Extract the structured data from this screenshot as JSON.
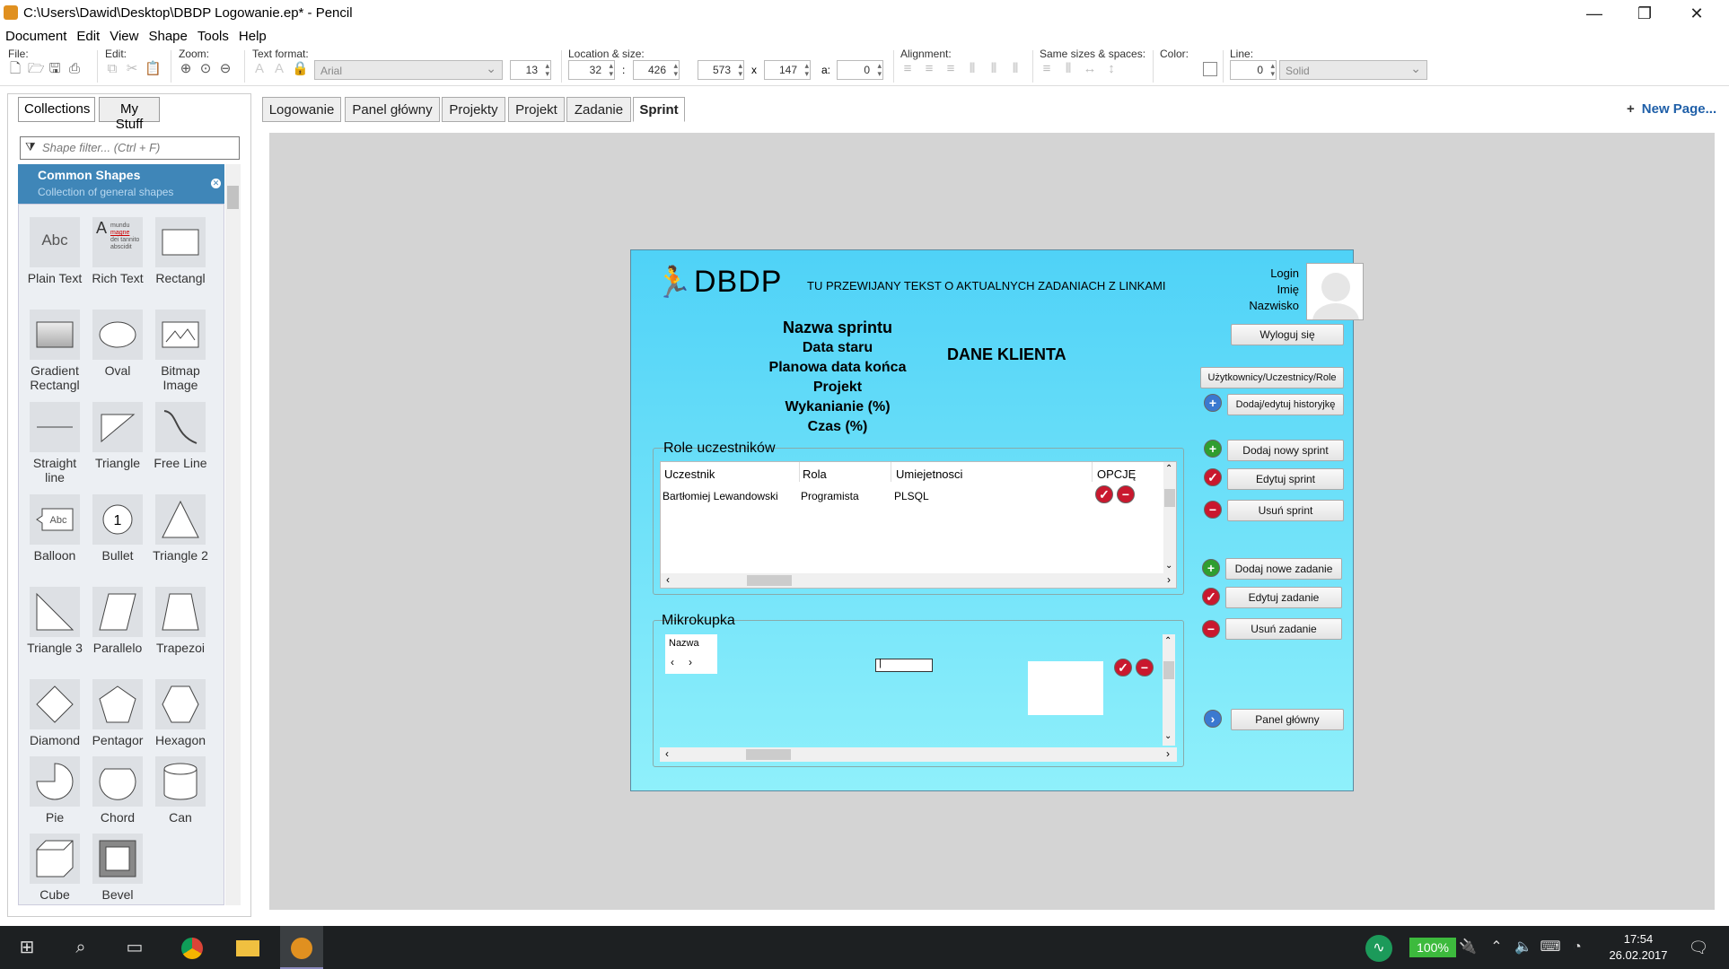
{
  "window": {
    "title": "C:\\Users\\Dawid\\Desktop\\DBDP Logowanie.ep* - Pencil",
    "minimize": "—",
    "restore": "❐",
    "close": "✕"
  },
  "menu": [
    "Document",
    "Edit",
    "View",
    "Shape",
    "Tools",
    "Help"
  ],
  "toolbar": {
    "file_label": "File:",
    "edit_label": "Edit:",
    "zoom_label": "Zoom:",
    "text_format_label": "Text format:",
    "font_value": "Arial",
    "font_size": "13",
    "location_label": "Location & size:",
    "x_value": "32",
    "colon": ":",
    "y_value": "426",
    "w_value": "573",
    "times": "x",
    "h_value": "147",
    "angle_label": "a:",
    "angle_value": "0",
    "alignment_label": "Alignment:",
    "same_sizes_label": "Same sizes & spaces:",
    "color_label": "Color:",
    "line_label": "Line:",
    "line_width": "0",
    "line_style": "Solid"
  },
  "left_panel": {
    "tabs": [
      "Collections",
      "My Stuff"
    ],
    "filter_placeholder": "Shape filter... (Ctrl + F)",
    "collection_title": "Common Shapes",
    "collection_subtitle": "Collection of general shapes",
    "shapes": [
      "Plain Text",
      "Rich Text",
      "Rectangl",
      "Gradient Rectangl",
      "Oval",
      "Bitmap Image",
      "Straight line",
      "Triangle",
      "Free Line",
      "Balloon",
      "Bullet",
      "Triangle 2",
      "Triangle 3",
      "Parallelo",
      "Trapezoi",
      "Diamond",
      "Pentagor",
      "Hexagon",
      "Pie",
      "Chord",
      "Can",
      "Cube",
      "Bevel"
    ],
    "icon_texts": {
      "plain": "Abc",
      "balloon": "Abc",
      "bullet": "1",
      "rich_big": "A",
      "rich_small": [
        "mundu",
        "magne",
        "dei tannito",
        "abscidit"
      ]
    }
  },
  "page_tabs": [
    "Logowanie",
    "Panel główny",
    "Projekty",
    "Projekt",
    "Zadanie",
    "Sprint"
  ],
  "active_tab": "Sprint",
  "new_page": "New Page...",
  "mockup": {
    "logo": "DBDP",
    "ticker": "TU PRZEWIJANY TEKST O AKTUALNYCH ZADANIACH Z LINKAMI",
    "user": {
      "login": "Login",
      "name": "Imię",
      "surname": "Nazwisko"
    },
    "logout": "Wyloguj się",
    "sprint_info": [
      "Nazwa sprintu",
      "Data staru",
      "Planowa data końca",
      "Projekt",
      "Wykanianie (%)",
      "Czas (%)"
    ],
    "client": "DANE KLIENTA",
    "roles_title": "Role uczestników",
    "roles_headers": [
      "Uczestnik",
      "Rola",
      "Umiejetnosci",
      "OPCJĘ"
    ],
    "roles_row": [
      "Bartłomiej Lewandowski",
      "Programista",
      "PLSQL"
    ],
    "micro_title": "Mikrokupka",
    "micro_header": "Nazwa",
    "buttons": {
      "users": "Użytkownicy/Uczestnicy/Role",
      "history": "Dodaj/edytuj historyjkę",
      "add_sprint": "Dodaj nowy sprint",
      "edit_sprint": "Edytuj sprint",
      "del_sprint": "Usuń sprint",
      "add_task": "Dodaj nowe zadanie",
      "edit_task": "Edytuj zadanie",
      "del_task": "Usuń zadanie",
      "main_panel": "Panel główny"
    },
    "colors": {
      "bg_top": "#4fd2f7",
      "bg_bottom": "#8ff0fb"
    }
  },
  "taskbar": {
    "battery": "100%",
    "time": "17:54",
    "date": "26.02.2017"
  }
}
